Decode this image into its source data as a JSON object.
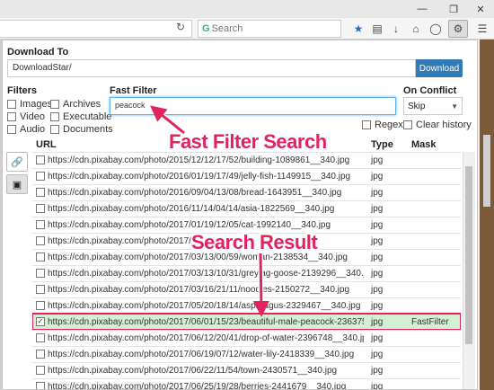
{
  "browser": {
    "search_placeholder": "Search",
    "search_g": "G"
  },
  "panel": {
    "download_to_label": "Download To",
    "download_path": "DownloadStar/",
    "download_button": "Download",
    "filters_label": "Filters",
    "filters": [
      "Images",
      "Archives",
      "Video",
      "Executable",
      "Audio",
      "Documents"
    ],
    "fast_filter_label": "Fast Filter",
    "fast_filter_value": "peacock",
    "on_conflict_label": "On Conflict",
    "on_conflict_value": "Skip",
    "regex_label": "Regex",
    "clear_history_label": "Clear history",
    "columns": {
      "url": "URL",
      "type": "Type",
      "mask": "Mask"
    }
  },
  "rows": [
    {
      "url": "https://cdn.pixabay.com/photo/2015/12/12/17/52/building-1089861__340.jpg",
      "type": "jpg",
      "mask": "",
      "checked": false
    },
    {
      "url": "https://cdn.pixabay.com/photo/2016/01/19/17/49/jelly-fish-1149915__340.jpg",
      "type": "jpg",
      "mask": "",
      "checked": false
    },
    {
      "url": "https://cdn.pixabay.com/photo/2016/09/04/13/08/bread-1643951__340.jpg",
      "type": "jpg",
      "mask": "",
      "checked": false
    },
    {
      "url": "https://cdn.pixabay.com/photo/2016/11/14/04/14/asia-1822569__340.jpg",
      "type": "jpg",
      "mask": "",
      "checked": false
    },
    {
      "url": "https://cdn.pixabay.com/photo/2017/01/19/12/05/cat-1992140__340.jpg",
      "type": "jpg",
      "mask": "",
      "checked": false
    },
    {
      "url": "https://cdn.pixabay.com/photo/2017/03/",
      "type": "jpg",
      "mask": "",
      "checked": false
    },
    {
      "url": "https://cdn.pixabay.com/photo/2017/03/13/00/59/woman-2138534__340.jpg",
      "type": "jpg",
      "mask": "",
      "checked": false
    },
    {
      "url": "https://cdn.pixabay.com/photo/2017/03/13/10/31/greylag-goose-2139296__340.jpg",
      "type": "jpg",
      "mask": "",
      "checked": false
    },
    {
      "url": "https://cdn.pixabay.com/photo/2017/03/16/21/11/noodles-2150272__340.jpg",
      "type": "jpg",
      "mask": "",
      "checked": false
    },
    {
      "url": "https://cdn.pixabay.com/photo/2017/05/20/18/14/asparagus-2329467__340.jpg",
      "type": "jpg",
      "mask": "",
      "checked": false
    },
    {
      "url": "https://cdn.pixabay.com/photo/2017/06/01/15/23/beautiful-male-peacock-2363750__...",
      "type": "jpg",
      "mask": "FastFilter",
      "checked": true
    },
    {
      "url": "https://cdn.pixabay.com/photo/2017/06/12/20/41/drop-of-water-2396748__340.jpg",
      "type": "jpg",
      "mask": "",
      "checked": false
    },
    {
      "url": "https://cdn.pixabay.com/photo/2017/06/19/07/12/water-lily-2418339__340.jpg",
      "type": "jpg",
      "mask": "",
      "checked": false
    },
    {
      "url": "https://cdn.pixabay.com/photo/2017/06/22/11/54/town-2430571__340.jpg",
      "type": "jpg",
      "mask": "",
      "checked": false
    },
    {
      "url": "https://cdn.pixabay.com/photo/2017/06/25/19/28/berries-2441679__340.jpg",
      "type": "jpg",
      "mask": "",
      "checked": false
    }
  ],
  "annotations": {
    "fast_filter_search": "Fast Filter Search",
    "search_result": "Search Result"
  },
  "colors": {
    "accent": "#e0245e",
    "button": "#337ab7",
    "highlight_row": "#d4f0d4"
  }
}
